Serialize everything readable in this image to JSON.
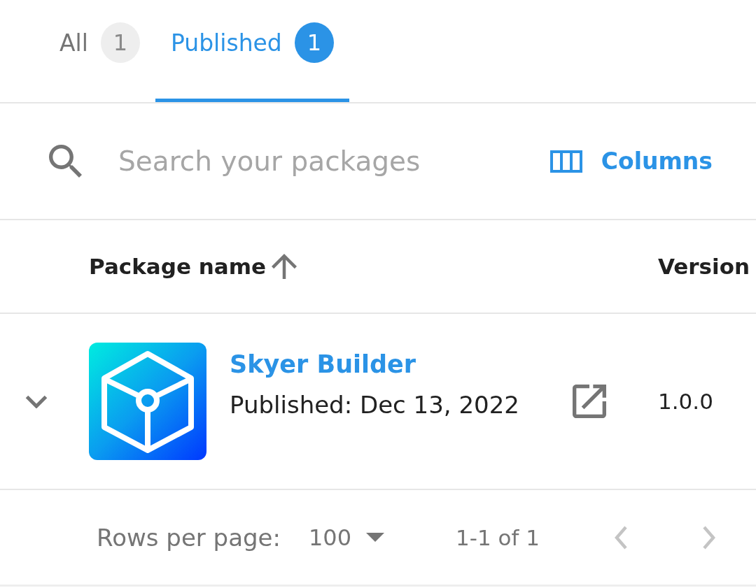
{
  "tabs": [
    {
      "label": "All",
      "count": "1",
      "selected": false
    },
    {
      "label": "Published",
      "count": "1",
      "selected": true
    }
  ],
  "search": {
    "placeholder": "Search your packages"
  },
  "toolbar": {
    "columns_button": "Columns"
  },
  "table": {
    "columns": [
      {
        "label": "Package name",
        "sorted": true,
        "ascending": true
      },
      {
        "label": "Version",
        "sorted": false
      }
    ],
    "rows": [
      {
        "name": "Skyer Builder",
        "published": "Published: Dec 13, 2022",
        "version": "1.0.0",
        "expanded": false
      }
    ]
  },
  "pagination": {
    "rows_per_page_label": "Rows per page:",
    "rows_per_page": "100",
    "range": "1-1 of 1",
    "previous_disabled": true,
    "next_disabled": true
  }
}
